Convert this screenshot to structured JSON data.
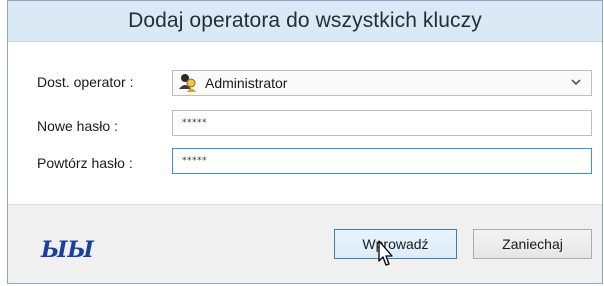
{
  "window": {
    "title": "Dodaj operatora do wszystkich kluczy"
  },
  "form": {
    "operator_label": "Dost. operator :",
    "operator_value": "Administrator",
    "operator_icon": "user-icon",
    "new_password_label": "Nowe hasło :",
    "new_password_value": "*****",
    "repeat_password_label": "Powtórz hasło :",
    "repeat_password_value": "*****"
  },
  "footer": {
    "logo_text": "ЫЫ",
    "submit_label": "Wprowadź",
    "cancel_label": "Zaniechaj"
  },
  "colors": {
    "titlebar_bg": "#dbe9f5",
    "footer_bg": "#f0f0f0",
    "focus_border": "#3b93d6",
    "logo_color": "#1a3fa0"
  }
}
